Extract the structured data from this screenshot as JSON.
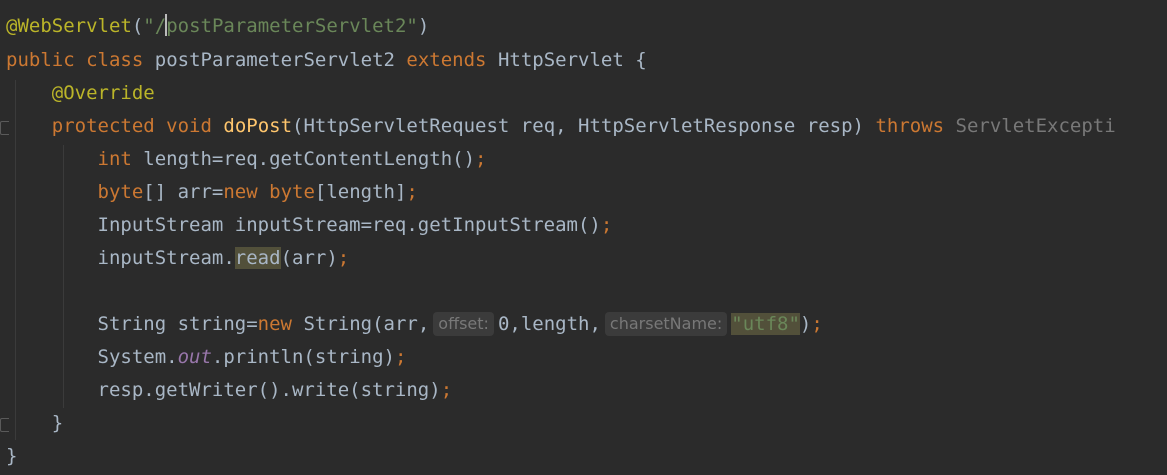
{
  "editor": {
    "theme": "darcula",
    "colors": {
      "background": "#2b2b2b",
      "keyword": "#cc7832",
      "annotation": "#bbb529",
      "string": "#6a8759",
      "method": "#ffc66d",
      "field": "#9876aa",
      "text": "#a9b7c6"
    },
    "lines": {
      "l1": {
        "annotation": "@WebServlet",
        "open": "(",
        "str_a": "\"/",
        "str_b": "postParameterServlet2\"",
        "close": ")"
      },
      "l2": {
        "kw_public": "public",
        "kw_class": "class",
        "name": "postParameterServlet2",
        "kw_extends": "extends",
        "parent": "HttpServlet",
        "brace": "{"
      },
      "l3": {
        "annotation": "@Override"
      },
      "l4": {
        "kw_protected": "protected",
        "kw_void": "void",
        "method": "doPost",
        "params": "(HttpServletRequest req, HttpServletResponse resp)",
        "kw_throws": "throws",
        "exception": "ServletExcepti"
      },
      "l5": {
        "kw_int": "int",
        "rest": " length=req.getContentLength()",
        "semi": ";"
      },
      "l6": {
        "kw_byte": "byte",
        "mid": "[] arr=",
        "kw_new": "new",
        "kw_byte2": "byte",
        "rest": "[length]",
        "semi": ";"
      },
      "l7": {
        "text": "InputStream inputStream=req.getInputStream()",
        "semi": ";"
      },
      "l8": {
        "obj": "inputStream.",
        "method": "read",
        "rest": "(arr)",
        "semi": ";"
      },
      "l10": {
        "start": "String string=",
        "kw_new": "new",
        "ctor": " String(arr,",
        "hint_offset": "offset:",
        "val_offset": "0",
        "mid": ",length,",
        "hint_charset": "charsetName:",
        "str": "\"utf8\"",
        "end": ")",
        "semi": ";"
      },
      "l11": {
        "start": "System.",
        "field": "out",
        "rest": ".println(string)",
        "semi": ";"
      },
      "l12": {
        "text": "resp.getWriter().write(string)",
        "semi": ";"
      },
      "l13": {
        "brace": "}"
      },
      "l14": {
        "brace": "}"
      }
    }
  }
}
